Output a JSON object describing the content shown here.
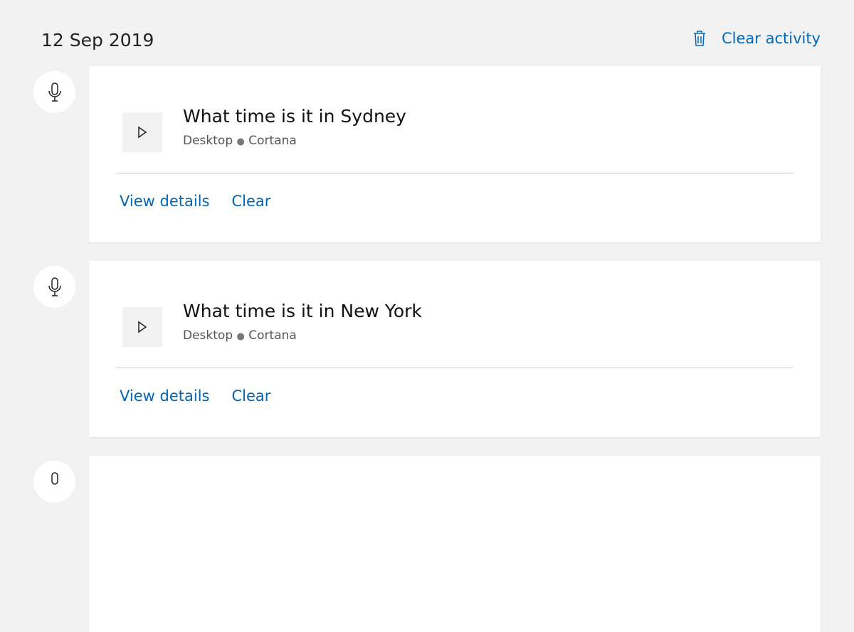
{
  "header": {
    "date": "12 Sep 2019",
    "clear_activity": "Clear activity"
  },
  "entries": [
    {
      "title": "What time is it in Sydney",
      "device": "Desktop",
      "separator": "●",
      "source": "Cortana",
      "view_details": "View details",
      "clear": "Clear"
    },
    {
      "title": "What time is it in New York",
      "device": "Desktop",
      "separator": "●",
      "source": "Cortana",
      "view_details": "View details",
      "clear": "Clear"
    }
  ],
  "colors": {
    "link": "#0067b8",
    "background": "#f2f2f2"
  }
}
